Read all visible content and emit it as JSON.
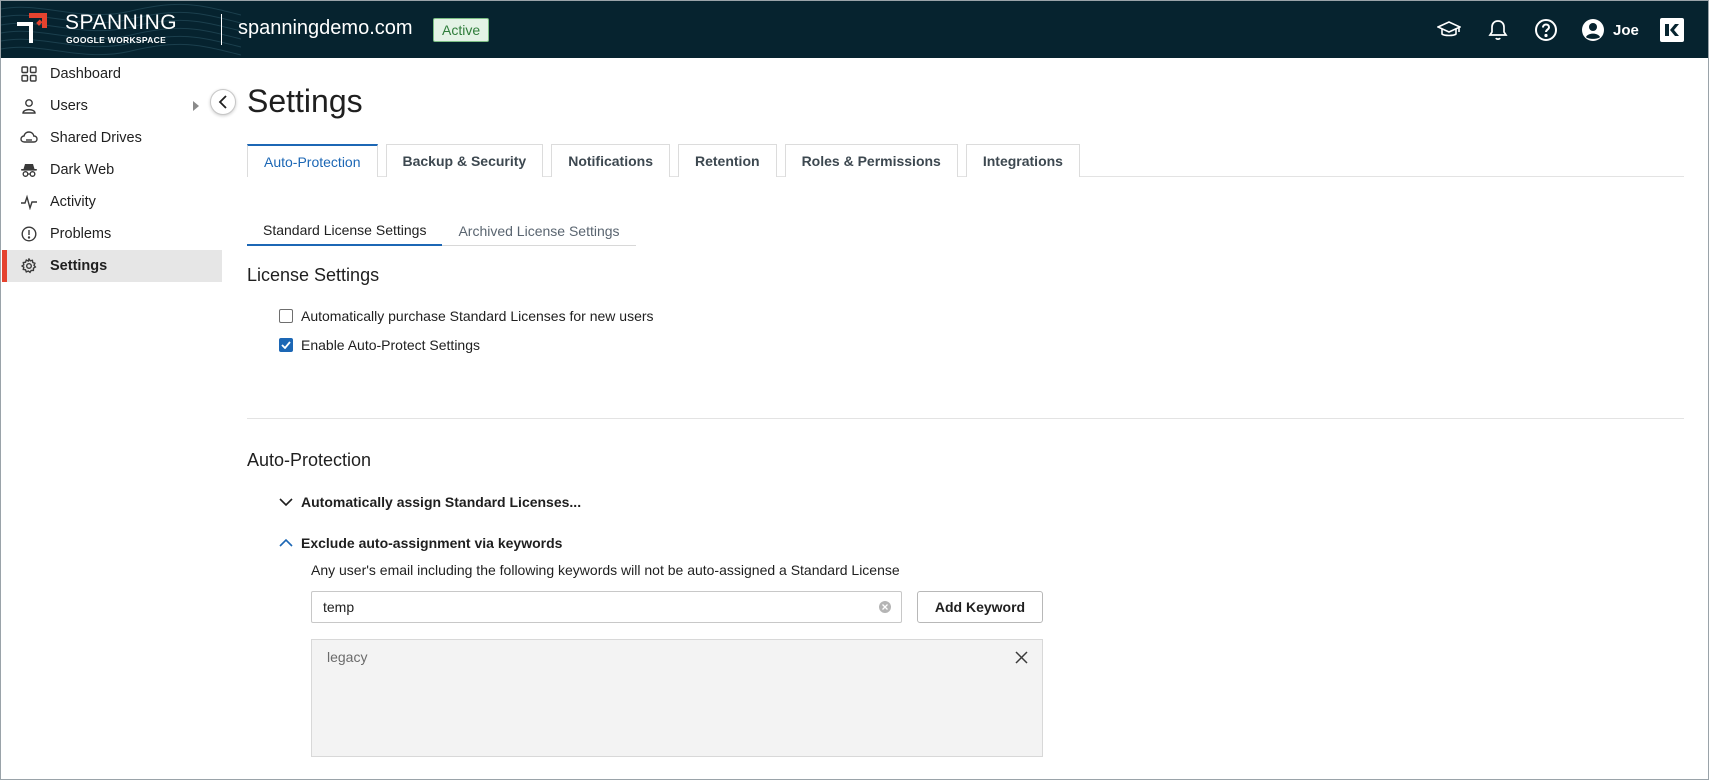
{
  "header": {
    "brand_name": "SPANNING",
    "brand_sub": "GOOGLE WORKSPACE",
    "domain": "spanningdemo.com",
    "status": "Active",
    "user_name": "Joe",
    "icons": [
      "graduation-cap-icon",
      "bell-icon",
      "help-icon",
      "user-circle-icon",
      "kaseya-logo"
    ]
  },
  "sidebar": {
    "items": [
      {
        "label": "Dashboard",
        "icon": "dashboard-grid-icon"
      },
      {
        "label": "Users",
        "icon": "user-icon"
      },
      {
        "label": "Shared Drives",
        "icon": "cloud-drive-icon"
      },
      {
        "label": "Dark Web",
        "icon": "spy-icon"
      },
      {
        "label": "Activity",
        "icon": "activity-pulse-icon"
      },
      {
        "label": "Problems",
        "icon": "alert-circle-icon"
      },
      {
        "label": "Settings",
        "icon": "gear-icon"
      }
    ],
    "active": "Settings"
  },
  "main": {
    "title": "Settings",
    "tabs": [
      {
        "label": "Auto-Protection",
        "selected": true
      },
      {
        "label": "Backup & Security"
      },
      {
        "label": "Notifications"
      },
      {
        "label": "Retention"
      },
      {
        "label": "Roles & Permissions"
      },
      {
        "label": "Integrations"
      }
    ],
    "subtabs": [
      {
        "label": "Standard License Settings",
        "selected": true
      },
      {
        "label": "Archived License Settings"
      }
    ],
    "license_settings": {
      "title": "License Settings",
      "options": [
        {
          "label": "Automatically purchase Standard Licenses for new users",
          "checked": false
        },
        {
          "label": "Enable Auto-Protect Settings",
          "checked": true
        }
      ]
    },
    "auto_protection": {
      "title": "Auto-Protection",
      "assign_label": "Automatically assign Standard Licenses...",
      "exclude_label": "Exclude auto-assignment via keywords",
      "description": "Any user's email including the following keywords will not be auto-assigned a Standard License",
      "keyword_input_value": "temp",
      "add_button": "Add Keyword",
      "keywords": [
        "legacy"
      ]
    }
  },
  "colors": {
    "header_bg": "#06232f",
    "accent_blue": "#1c67b5",
    "active_marker": "#e5432f",
    "status_green": "#2f7d3b"
  }
}
